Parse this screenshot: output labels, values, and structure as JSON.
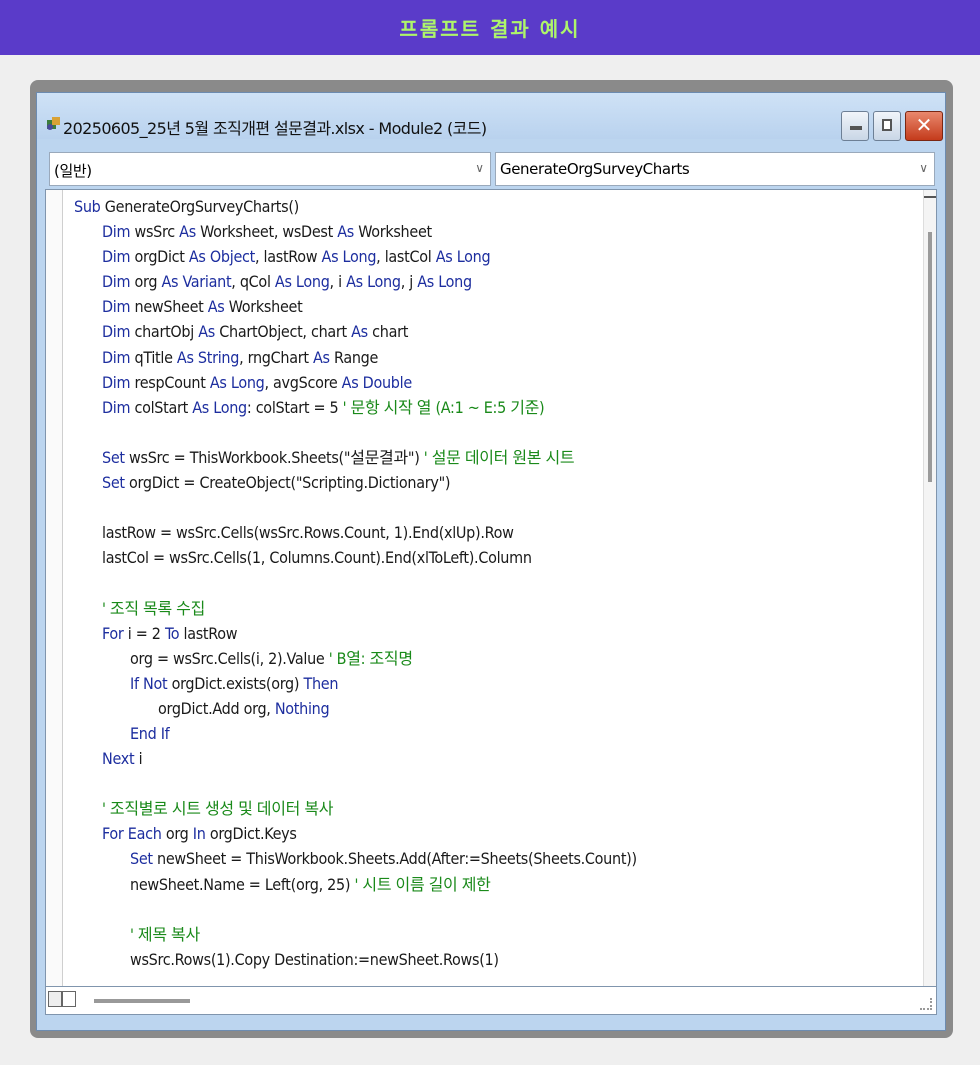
{
  "banner": {
    "text": "프롬프트 결과 예시"
  },
  "window": {
    "title": "20250605_25년 5월 조직개편 설문결과.xlsx - Module2 (코드)",
    "object_combo": "(일반)",
    "proc_combo": "GenerateOrgSurveyCharts"
  },
  "icons": {
    "app": "vba-editor-icon",
    "minimize": "minimize-icon",
    "maximize": "maximize-icon",
    "close": "close-icon",
    "dropdown": "chevron-down-icon"
  },
  "colors": {
    "keyword": "#1d2e9f",
    "comment": "#1a8a1a",
    "banner": "#5a3bc9",
    "banner_text": "#aef56a"
  },
  "code_lines": [
    {
      "indent": 0,
      "segments": [
        {
          "t": "Sub",
          "k": "kw"
        },
        {
          "t": " GenerateOrgSurveyCharts()",
          "k": ""
        }
      ]
    },
    {
      "indent": 1,
      "segments": [
        {
          "t": "Dim",
          "k": "kw"
        },
        {
          "t": " wsSrc ",
          "k": ""
        },
        {
          "t": "As",
          "k": "kw"
        },
        {
          "t": " Worksheet, wsDest ",
          "k": ""
        },
        {
          "t": "As",
          "k": "kw"
        },
        {
          "t": " Worksheet",
          "k": ""
        }
      ]
    },
    {
      "indent": 1,
      "segments": [
        {
          "t": "Dim",
          "k": "kw"
        },
        {
          "t": " orgDict ",
          "k": ""
        },
        {
          "t": "As Object",
          "k": "kw"
        },
        {
          "t": ", lastRow ",
          "k": ""
        },
        {
          "t": "As Long",
          "k": "kw"
        },
        {
          "t": ", lastCol ",
          "k": ""
        },
        {
          "t": "As Long",
          "k": "kw"
        }
      ]
    },
    {
      "indent": 1,
      "segments": [
        {
          "t": "Dim",
          "k": "kw"
        },
        {
          "t": " org ",
          "k": ""
        },
        {
          "t": "As Variant",
          "k": "kw"
        },
        {
          "t": ", qCol ",
          "k": ""
        },
        {
          "t": "As Long",
          "k": "kw"
        },
        {
          "t": ", i ",
          "k": ""
        },
        {
          "t": "As Long",
          "k": "kw"
        },
        {
          "t": ", j ",
          "k": ""
        },
        {
          "t": "As Long",
          "k": "kw"
        }
      ]
    },
    {
      "indent": 1,
      "segments": [
        {
          "t": "Dim",
          "k": "kw"
        },
        {
          "t": " newSheet ",
          "k": ""
        },
        {
          "t": "As",
          "k": "kw"
        },
        {
          "t": " Worksheet",
          "k": ""
        }
      ]
    },
    {
      "indent": 1,
      "segments": [
        {
          "t": "Dim",
          "k": "kw"
        },
        {
          "t": " chartObj ",
          "k": ""
        },
        {
          "t": "As",
          "k": "kw"
        },
        {
          "t": " ChartObject, chart ",
          "k": ""
        },
        {
          "t": "As",
          "k": "kw"
        },
        {
          "t": " chart",
          "k": ""
        }
      ]
    },
    {
      "indent": 1,
      "segments": [
        {
          "t": "Dim",
          "k": "kw"
        },
        {
          "t": " qTitle ",
          "k": ""
        },
        {
          "t": "As String",
          "k": "kw"
        },
        {
          "t": ", rngChart ",
          "k": ""
        },
        {
          "t": "As",
          "k": "kw"
        },
        {
          "t": " Range",
          "k": ""
        }
      ]
    },
    {
      "indent": 1,
      "segments": [
        {
          "t": "Dim",
          "k": "kw"
        },
        {
          "t": " respCount ",
          "k": ""
        },
        {
          "t": "As Long",
          "k": "kw"
        },
        {
          "t": ", avgScore ",
          "k": ""
        },
        {
          "t": "As Double",
          "k": "kw"
        }
      ]
    },
    {
      "indent": 1,
      "segments": [
        {
          "t": "Dim",
          "k": "kw"
        },
        {
          "t": " colStart ",
          "k": ""
        },
        {
          "t": "As Long",
          "k": "kw"
        },
        {
          "t": ": colStart = 5 ",
          "k": ""
        },
        {
          "t": "' 문항 시작 열 (A:1 ~ E:5 기준)",
          "k": "cm"
        }
      ]
    },
    {
      "indent": 0,
      "segments": []
    },
    {
      "indent": 1,
      "segments": [
        {
          "t": "Set",
          "k": "kw"
        },
        {
          "t": " wsSrc = ThisWorkbook.Sheets(\"설문결과\") ",
          "k": ""
        },
        {
          "t": "' 설문 데이터 원본 시트",
          "k": "cm"
        }
      ]
    },
    {
      "indent": 1,
      "segments": [
        {
          "t": "Set",
          "k": "kw"
        },
        {
          "t": " orgDict = CreateObject(\"Scripting.Dictionary\")",
          "k": ""
        }
      ]
    },
    {
      "indent": 0,
      "segments": []
    },
    {
      "indent": 1,
      "segments": [
        {
          "t": "lastRow = wsSrc.Cells(wsSrc.Rows.Count, 1).End(xlUp).Row",
          "k": ""
        }
      ]
    },
    {
      "indent": 1,
      "segments": [
        {
          "t": "lastCol = wsSrc.Cells(1, Columns.Count).End(xlToLeft).Column",
          "k": ""
        }
      ]
    },
    {
      "indent": 0,
      "segments": []
    },
    {
      "indent": 1,
      "segments": [
        {
          "t": "' 조직 목록 수집",
          "k": "cm"
        }
      ]
    },
    {
      "indent": 1,
      "segments": [
        {
          "t": "For",
          "k": "kw"
        },
        {
          "t": " i = 2 ",
          "k": ""
        },
        {
          "t": "To",
          "k": "kw"
        },
        {
          "t": " lastRow",
          "k": ""
        }
      ]
    },
    {
      "indent": 2,
      "segments": [
        {
          "t": "org = wsSrc.Cells(i, 2).Value ",
          "k": ""
        },
        {
          "t": "' B열: 조직명",
          "k": "cm"
        }
      ]
    },
    {
      "indent": 2,
      "segments": [
        {
          "t": "If Not",
          "k": "kw"
        },
        {
          "t": " orgDict.exists(org) ",
          "k": ""
        },
        {
          "t": "Then",
          "k": "kw"
        }
      ]
    },
    {
      "indent": 3,
      "segments": [
        {
          "t": "orgDict.Add org, ",
          "k": ""
        },
        {
          "t": "Nothing",
          "k": "kw"
        }
      ]
    },
    {
      "indent": 2,
      "segments": [
        {
          "t": "End If",
          "k": "kw"
        }
      ]
    },
    {
      "indent": 1,
      "segments": [
        {
          "t": "Next",
          "k": "kw"
        },
        {
          "t": " i",
          "k": ""
        }
      ]
    },
    {
      "indent": 0,
      "segments": []
    },
    {
      "indent": 1,
      "segments": [
        {
          "t": "' 조직별로 시트 생성 및 데이터 복사",
          "k": "cm"
        }
      ]
    },
    {
      "indent": 1,
      "segments": [
        {
          "t": "For Each",
          "k": "kw"
        },
        {
          "t": " org ",
          "k": ""
        },
        {
          "t": "In",
          "k": "kw"
        },
        {
          "t": " orgDict.Keys",
          "k": ""
        }
      ]
    },
    {
      "indent": 2,
      "segments": [
        {
          "t": "Set",
          "k": "kw"
        },
        {
          "t": " newSheet = ThisWorkbook.Sheets.Add(After:=Sheets(Sheets.Count))",
          "k": ""
        }
      ]
    },
    {
      "indent": 2,
      "segments": [
        {
          "t": "newSheet.Name = Left(org, 25) ",
          "k": ""
        },
        {
          "t": "' 시트 이름 길이 제한",
          "k": "cm"
        }
      ]
    },
    {
      "indent": 0,
      "segments": []
    },
    {
      "indent": 2,
      "segments": [
        {
          "t": "' 제목 복사",
          "k": "cm"
        }
      ]
    },
    {
      "indent": 2,
      "segments": [
        {
          "t": "wsSrc.Rows(1).Copy Destination:=newSheet.Rows(1)",
          "k": ""
        }
      ]
    }
  ]
}
